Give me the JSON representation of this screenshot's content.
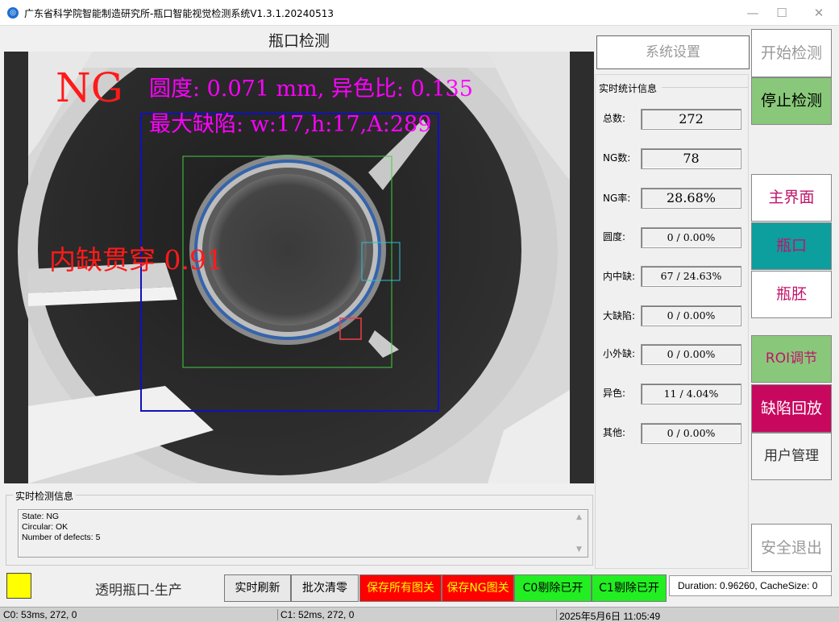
{
  "window": {
    "title": "广东省科学院智能制造研究所-瓶口智能视觉检测系统V1.3.1.20240513",
    "icon": "app-logo-icon"
  },
  "view": {
    "title": "瓶口检测",
    "overlay": {
      "result": "NG",
      "roundness_text": "圆度: 0.071 mm, 异色比: 0.135",
      "max_defect_text": "最大缺陷: w:17,h:17,A:289",
      "defect_type_text": "内缺贯穿 0.91"
    }
  },
  "log": {
    "legend": "实时检测信息",
    "lines": [
      "State: NG",
      "Circular: OK",
      "Number of defects: 5"
    ]
  },
  "settings_button": "系统设置",
  "stats": {
    "legend": "实时统计信息",
    "rows": [
      {
        "label": "总数:",
        "value": "272"
      },
      {
        "label": "NG数:",
        "value": "78"
      },
      {
        "label": "NG率:",
        "value": "28.68%"
      },
      {
        "label": "圆度:",
        "value": "0 / 0.00%"
      },
      {
        "label": "内中缺:",
        "value": "67 / 24.63%"
      },
      {
        "label": "大缺陷:",
        "value": "0 / 0.00%"
      },
      {
        "label": "小外缺:",
        "value": "0 / 0.00%"
      },
      {
        "label": "异色:",
        "value": "11 / 4.04%"
      },
      {
        "label": "其他:",
        "value": "0 / 0.00%"
      }
    ]
  },
  "right_buttons": {
    "start": "开始检测",
    "stop": "停止检测",
    "main": "主界面",
    "mouth": "瓶口",
    "preform": "瓶胚",
    "roi": "ROI调节",
    "replay": "缺陷回放",
    "user": "用户管理",
    "exit": "安全退出"
  },
  "bottom": {
    "mode": "透明瓶口-生产",
    "refresh": "实时刷新",
    "batch_reset": "批次清零",
    "save_all": "保存所有图关",
    "save_ng": "保存NG图关",
    "c0_reject": "C0剔除已开",
    "c1_reject": "C1剔除已开",
    "duration": "Duration: 0.96260, CacheSize: 0"
  },
  "statusbar": {
    "c0": "C0: 53ms, 272, 0",
    "c1": "C1: 52ms, 272, 0",
    "datetime": "2025年5月6日 11:05:49"
  },
  "colors": {
    "ok_green": "#89c87a",
    "accent_teal": "#0d9e9e",
    "accent_magenta": "#c8085f",
    "alarm_red": "#ff0000",
    "reject_green": "#22ee22",
    "indicator_yellow": "#ffff00"
  }
}
